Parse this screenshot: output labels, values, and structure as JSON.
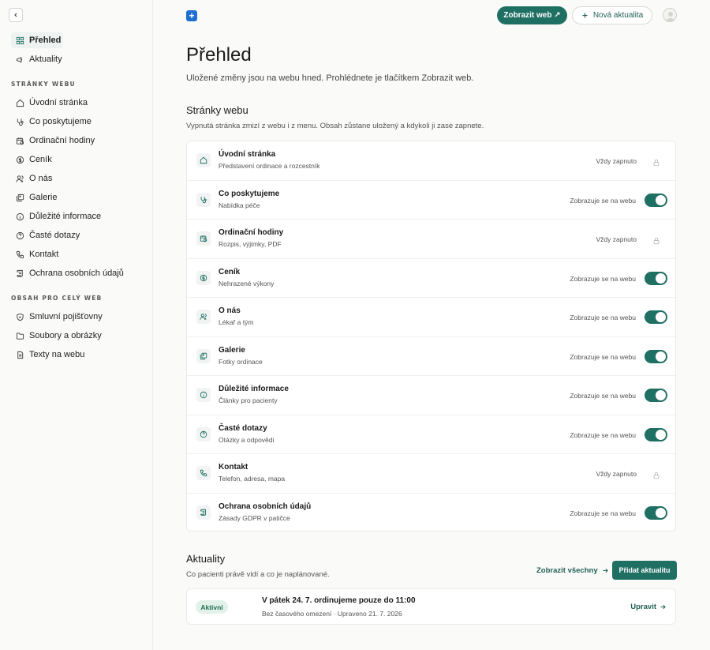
{
  "sidebar": {
    "top": [
      {
        "label": "Přehled",
        "icon": "grid-icon",
        "active": true
      },
      {
        "label": "Aktuality",
        "icon": "megaphone-icon"
      }
    ],
    "section1_title": "STRÁNKY WEBU",
    "pages": [
      {
        "label": "Úvodní stránka",
        "icon": "home-icon"
      },
      {
        "label": "Co poskytujeme",
        "icon": "stethoscope-icon"
      },
      {
        "label": "Ordinační hodiny",
        "icon": "calendar-clock-icon"
      },
      {
        "label": "Ceník",
        "icon": "dollar-icon"
      },
      {
        "label": "O nás",
        "icon": "users-icon"
      },
      {
        "label": "Galerie",
        "icon": "images-icon"
      },
      {
        "label": "Důležité informace",
        "icon": "info-icon"
      },
      {
        "label": "Časté dotazy",
        "icon": "help-icon"
      },
      {
        "label": "Kontakt",
        "icon": "phone-icon"
      },
      {
        "label": "Ochrana osobních údajů",
        "icon": "scroll-icon"
      }
    ],
    "section2_title": "OBSAH PRO CELÝ WEB",
    "global": [
      {
        "label": "Smluvní pojišťovny",
        "icon": "shield-icon"
      },
      {
        "label": "Soubory a obrázky",
        "icon": "folder-icon"
      },
      {
        "label": "Texty na webu",
        "icon": "file-text-icon"
      }
    ]
  },
  "header": {
    "view_site_label": "Zobrazit web ↗",
    "new_news_label": "Nová aktualita"
  },
  "main": {
    "title": "Přehled",
    "subtitle": "Uložené změny jsou na webu hned. Prohlédnete je tlačítkem Zobrazit web.",
    "pages_title": "Stránky webu",
    "pages_subtitle": "Vypnutá stránka zmizí z webu i z menu. Obsah zůstane uložený a kdykoli ji zase zapnete.",
    "pages": [
      {
        "title": "Úvodní stránka",
        "desc": "Představení ordinace a rozcestník",
        "status": "Vždy zapnuto",
        "locked": true
      },
      {
        "title": "Co poskytujeme",
        "desc": "Nabídka péče",
        "status": "Zobrazuje se na webu",
        "locked": false
      },
      {
        "title": "Ordinační hodiny",
        "desc": "Rozpis, výjimky, PDF",
        "status": "Vždy zapnuto",
        "locked": true
      },
      {
        "title": "Ceník",
        "desc": "Nehrazené výkony",
        "status": "Zobrazuje se na webu",
        "locked": false
      },
      {
        "title": "O nás",
        "desc": "Lékař a tým",
        "status": "Zobrazuje se na webu",
        "locked": false
      },
      {
        "title": "Galerie",
        "desc": "Fotky ordinace",
        "status": "Zobrazuje se na webu",
        "locked": false
      },
      {
        "title": "Důležité informace",
        "desc": "Články pro pacienty",
        "status": "Zobrazuje se na webu",
        "locked": false
      },
      {
        "title": "Časté dotazy",
        "desc": "Otázky a odpovědi",
        "status": "Zobrazuje se na webu",
        "locked": false
      },
      {
        "title": "Kontakt",
        "desc": "Telefon, adresa, mapa",
        "status": "Vždy zapnuto",
        "locked": true
      },
      {
        "title": "Ochrana osobních údajů",
        "desc": "Zásady GDPR v patičce",
        "status": "Zobrazuje se na webu",
        "locked": false
      }
    ],
    "news_title": "Aktuality",
    "news_subtitle": "Co pacienti právě vidí a co je naplánované.",
    "news_view_all": "Zobrazit všechny",
    "news_add": "Přidat aktualitu",
    "news_items": [
      {
        "badge": "Aktivní",
        "title": "V pátek 24. 7. ordinujeme pouze do 11:00",
        "meta": "Bez časového omezení · Upraveno 21. 7. 2026",
        "edit": "Upravit"
      }
    ]
  },
  "colors": {
    "accent": "#1f6f63",
    "badge_bg": "#e2f1ea",
    "plus_badge": "#1f6fd1"
  }
}
